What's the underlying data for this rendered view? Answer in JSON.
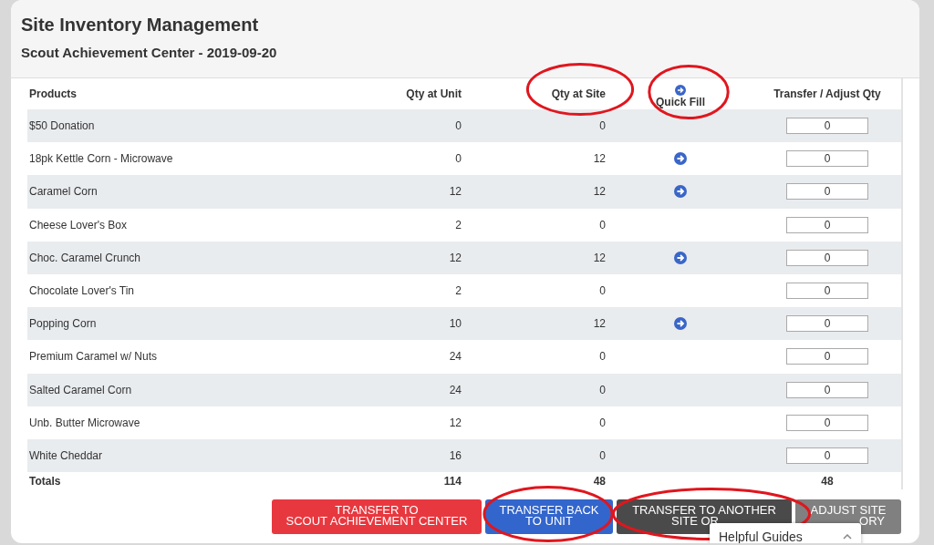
{
  "page": {
    "title": "Site Inventory Management",
    "subtitle": "Scout Achievement Center - 2019-09-20"
  },
  "columns": [
    {
      "label": "Products",
      "circled": false
    },
    {
      "label": "Qty at Unit",
      "circled": false
    },
    {
      "label": "Qty at Site",
      "circled": true
    },
    {
      "label": "Quick Fill",
      "circled": true
    },
    {
      "label": "Transfer / Adjust Qty",
      "circled": false
    }
  ],
  "rows": [
    {
      "product": "$50 Donation",
      "qty_unit": "0",
      "qty_site": "0",
      "quick_fill": false,
      "transfer": "0"
    },
    {
      "product": "18pk Kettle Corn - Microwave",
      "qty_unit": "0",
      "qty_site": "12",
      "quick_fill": true,
      "transfer": "0"
    },
    {
      "product": "Caramel Corn",
      "qty_unit": "12",
      "qty_site": "12",
      "quick_fill": true,
      "transfer": "0"
    },
    {
      "product": "Cheese Lover's Box",
      "qty_unit": "2",
      "qty_site": "0",
      "quick_fill": false,
      "transfer": "0"
    },
    {
      "product": "Choc. Caramel Crunch",
      "qty_unit": "12",
      "qty_site": "12",
      "quick_fill": true,
      "transfer": "0"
    },
    {
      "product": "Chocolate Lover's Tin",
      "qty_unit": "2",
      "qty_site": "0",
      "quick_fill": false,
      "transfer": "0"
    },
    {
      "product": "Popping Corn",
      "qty_unit": "10",
      "qty_site": "12",
      "quick_fill": true,
      "transfer": "0"
    },
    {
      "product": "Premium Caramel w/ Nuts",
      "qty_unit": "24",
      "qty_site": "0",
      "quick_fill": false,
      "transfer": "0"
    },
    {
      "product": "Salted Caramel Corn",
      "qty_unit": "24",
      "qty_site": "0",
      "quick_fill": false,
      "transfer": "0"
    },
    {
      "product": "Unb. Butter Microwave",
      "qty_unit": "12",
      "qty_site": "0",
      "quick_fill": false,
      "transfer": "0"
    },
    {
      "product": "White Cheddar",
      "qty_unit": "16",
      "qty_site": "0",
      "quick_fill": false,
      "transfer": "0"
    }
  ],
  "totals": {
    "label": "Totals",
    "qty_unit": "114",
    "qty_site": "48",
    "transfer": "48"
  },
  "buttons": [
    {
      "lines": [
        "TRANSFER TO",
        "SCOUT ACHIEVEMENT CENTER"
      ],
      "kind": "red",
      "circled": false
    },
    {
      "lines": [
        "TRANSFER BACK",
        "TO UNIT"
      ],
      "kind": "blue",
      "circled": true
    },
    {
      "lines": [
        "TRANSFER TO ANOTHER",
        "SITE OR"
      ],
      "kind": "dark",
      "circled": true
    },
    {
      "lines": [
        "ADJUST SITE",
        "ORY"
      ],
      "kind": "grey",
      "circled": false
    }
  ],
  "helpful_guides": {
    "label": "Helpful Guides",
    "expanded": false
  }
}
